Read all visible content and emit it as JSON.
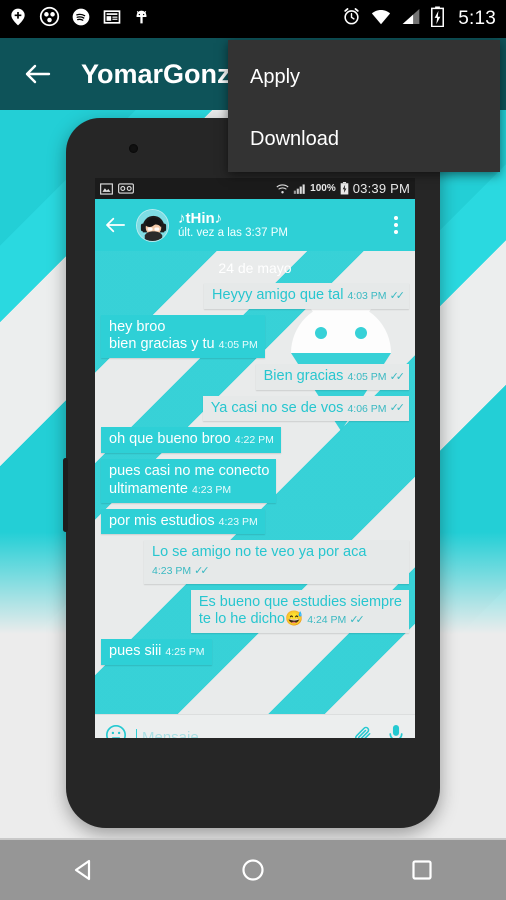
{
  "os_status_bar": {
    "notification_icons": [
      "location-pin-plus-icon",
      "soccer-ball-icon",
      "spotify-icon",
      "news-layout-icon",
      "android-bug-icon"
    ],
    "system_icons": [
      "alarm-clock-icon",
      "wifi-icon",
      "cellular-signal-icon",
      "battery-charging-icon"
    ],
    "clock": "5:13"
  },
  "app_bar": {
    "back_icon": "arrow-left-icon",
    "title": "YomarGonz",
    "background_color": "#0e5359"
  },
  "overflow_menu": {
    "items": [
      {
        "label": "Apply"
      },
      {
        "label": "Download"
      }
    ],
    "background_color": "#333333"
  },
  "preview": {
    "wallpaper_colors": [
      "#23cfd6",
      "#2ad9e0",
      "#eceeee"
    ],
    "phone_frame_color": "#262626",
    "inner_status_bar": {
      "left_icons": [
        "image-icon",
        "voicemail-icon"
      ],
      "right_icons": [
        "wifi-icon",
        "cellular-signal-icon",
        "battery-charging-icon"
      ],
      "battery_percent": "100%",
      "clock": "03:39 PM"
    },
    "chat_header": {
      "back_icon": "arrow-left-icon",
      "avatar": "contact-avatar",
      "contact_name": "♪tHin♪",
      "status": "últ. vez a las 3:37 PM",
      "overflow_icon": "kebab-menu-icon",
      "accent_color": "#2ed0d6"
    },
    "chat": {
      "date_divider": "24 de mayo",
      "watermark": "android-mascot-icon",
      "outgoing_bubble_color": "#e6e9e9",
      "incoming_bubble_color": "#2ed0d6",
      "messages": [
        {
          "dir": "out",
          "text": "Heyyy amigo que tal",
          "time": "4:03 PM",
          "ticks": "✓✓"
        },
        {
          "dir": "in",
          "text": "hey broo\nbien gracias y tu",
          "time": "4:05 PM",
          "ticks": ""
        },
        {
          "dir": "out",
          "text": "Bien gracias",
          "time": "4:05 PM",
          "ticks": "✓✓"
        },
        {
          "dir": "out",
          "text": "Ya casi no se de vos",
          "time": "4:06 PM",
          "ticks": "✓✓"
        },
        {
          "dir": "in",
          "text": "oh que bueno broo",
          "time": "4:22 PM",
          "ticks": ""
        },
        {
          "dir": "in",
          "text": "pues casi no me conecto\nultimamente",
          "time": "4:23 PM",
          "ticks": ""
        },
        {
          "dir": "in",
          "text": "por mis estudios",
          "time": "4:23 PM",
          "ticks": ""
        },
        {
          "dir": "out",
          "text": "Lo se amigo no te veo ya por aca",
          "time": "4:23 PM",
          "ticks": "✓✓"
        },
        {
          "dir": "out",
          "text": "Es bueno que estudies siempre\nte lo he dicho😅",
          "time": "4:24 PM",
          "ticks": "✓✓"
        },
        {
          "dir": "in",
          "text": "pues siii",
          "time": "4:25 PM",
          "ticks": ""
        }
      ]
    },
    "input_bar": {
      "emoji_icon": "emoji-smiley-icon",
      "placeholder": "Mensaje",
      "attach_icon": "paperclip-icon",
      "mic_icon": "microphone-icon"
    }
  },
  "nav_bar": {
    "back_icon": "nav-back-triangle-icon",
    "home_icon": "nav-home-circle-icon",
    "recents_icon": "nav-recents-square-icon",
    "background_color": "#969696"
  }
}
